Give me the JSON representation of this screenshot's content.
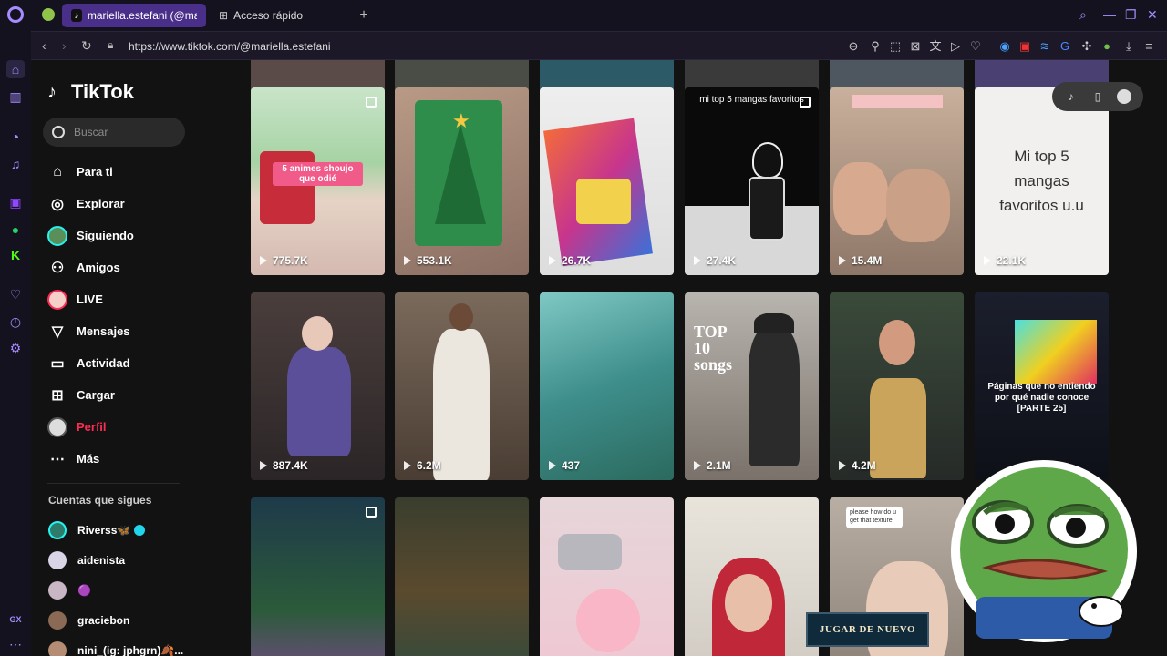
{
  "browser": {
    "tabs": [
      {
        "label": "mariella.estefani (@mariell",
        "active": true
      },
      {
        "label": "Acceso rápido",
        "active": false
      }
    ],
    "url": "https://www.tiktok.com/@mariella.estefani",
    "sidebar_bottom_label": "GX"
  },
  "tiktok": {
    "brand": "TikTok",
    "search_placeholder": "Buscar",
    "nav": [
      {
        "label": "Para ti",
        "icon": "home-icon"
      },
      {
        "label": "Explorar",
        "icon": "compass-icon"
      },
      {
        "label": "Siguiendo",
        "icon": "avatar"
      },
      {
        "label": "Amigos",
        "icon": "friends-icon"
      },
      {
        "label": "LIVE",
        "icon": "avatar"
      },
      {
        "label": "Mensajes",
        "icon": "send-icon"
      },
      {
        "label": "Actividad",
        "icon": "inbox-icon"
      },
      {
        "label": "Cargar",
        "icon": "plus-square-icon"
      },
      {
        "label": "Perfil",
        "icon": "avatar",
        "selected": true
      },
      {
        "label": "Más",
        "icon": "dots-icon"
      }
    ],
    "following_title": "Cuentas que sigues",
    "following": [
      {
        "name": "Riverss🦋",
        "verified": true
      },
      {
        "name": "aidenista",
        "verified": false
      },
      {
        "name": "🟣",
        "verified": false
      },
      {
        "name": "graciebon",
        "verified": false
      },
      {
        "name": "nini_(ig: jphgrn)🍂...",
        "verified": false
      }
    ]
  },
  "videos": [
    {
      "views": "775.7K",
      "caption": "5 animes shoujo que odié",
      "pinned": true
    },
    {
      "views": "553.1K",
      "caption": "",
      "pinned": false
    },
    {
      "views": "26.7K",
      "caption": "",
      "pinned": false
    },
    {
      "views": "27.4K",
      "caption": "mi top 5 mangas favoritos",
      "pinned": true
    },
    {
      "views": "15.4M",
      "caption": "",
      "pinned": false
    },
    {
      "views": "22.1K",
      "caption": "Mi top 5 mangas favoritos u.u",
      "pinned": false
    },
    {
      "views": "887.4K",
      "caption": "",
      "pinned": false
    },
    {
      "views": "6.2M",
      "caption": "",
      "pinned": false
    },
    {
      "views": "437",
      "caption": "",
      "pinned": false
    },
    {
      "views": "2.1M",
      "caption": "TOP 10 songs",
      "pinned": false
    },
    {
      "views": "4.2M",
      "caption": "",
      "pinned": false
    },
    {
      "views": "",
      "caption": "Páginas que no entiendo por qué nadie conoce [PARTE 25]",
      "pinned": false
    },
    {
      "views": "",
      "caption": "",
      "pinned": true
    },
    {
      "views": "",
      "caption": "",
      "pinned": false
    },
    {
      "views": "",
      "caption": "",
      "pinned": false
    },
    {
      "views": "",
      "caption": "",
      "pinned": false
    },
    {
      "views": "",
      "caption": "please how do u get that texture",
      "pinned": false
    }
  ],
  "overlay": {
    "replay_button": "JUGAR DE NUEVO"
  },
  "colors": {
    "accent": "#fe2c55",
    "opera": "#a58cff",
    "tab_active": "#4a2f8a"
  }
}
